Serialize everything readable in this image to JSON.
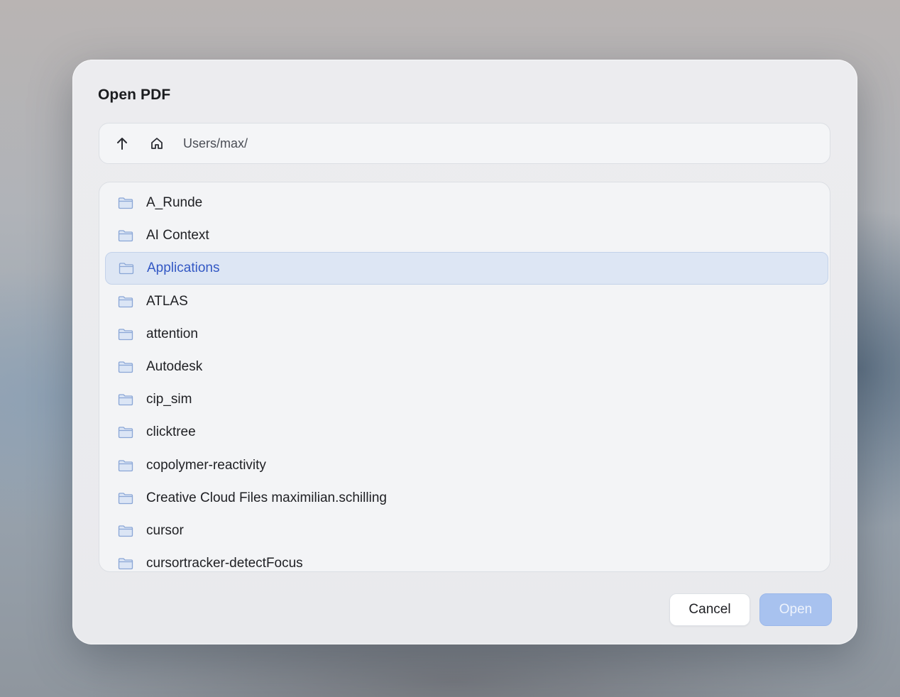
{
  "dialog": {
    "title": "Open PDF"
  },
  "pathbar": {
    "up_icon": "arrow-up-icon",
    "home_icon": "home-icon",
    "path": "Users/max/"
  },
  "folders": {
    "items": [
      {
        "label": "A_Runde",
        "icon": "folder-icon",
        "selected": false
      },
      {
        "label": "AI Context",
        "icon": "folder-icon",
        "selected": false
      },
      {
        "label": "Applications",
        "icon": "folder-icon",
        "selected": true
      },
      {
        "label": "ATLAS",
        "icon": "folder-icon",
        "selected": false
      },
      {
        "label": "attention",
        "icon": "folder-icon",
        "selected": false
      },
      {
        "label": "Autodesk",
        "icon": "folder-icon",
        "selected": false
      },
      {
        "label": "cip_sim",
        "icon": "folder-icon",
        "selected": false
      },
      {
        "label": "clicktree",
        "icon": "folder-icon",
        "selected": false
      },
      {
        "label": "copolymer-reactivity",
        "icon": "folder-icon",
        "selected": false
      },
      {
        "label": "Creative Cloud Files maximilian.schilling",
        "icon": "folder-icon",
        "selected": false
      },
      {
        "label": "cursor",
        "icon": "folder-icon",
        "selected": false
      },
      {
        "label": "cursortracker-detectFocus",
        "icon": "folder-icon",
        "selected": false
      }
    ]
  },
  "actions": {
    "cancel_label": "Cancel",
    "open_label": "Open"
  },
  "colors": {
    "accent": "#3358c4",
    "selected_row": "#dde6f4",
    "open_button_disabled": "#a8c2ef",
    "folder_icon": "#8aa6d6"
  }
}
